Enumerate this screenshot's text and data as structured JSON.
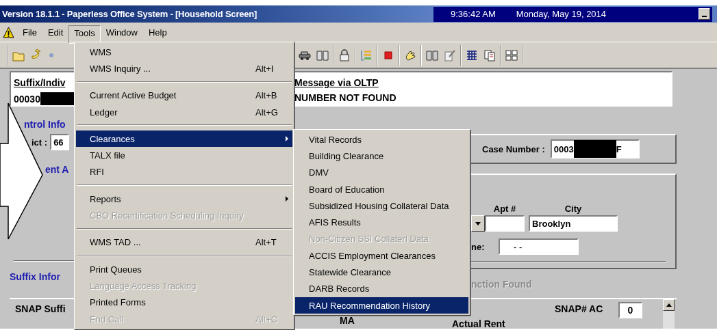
{
  "window": {
    "title": "Version 18.1.1 - Paperless Office System - [Household Screen]",
    "time": "9:36:42 AM",
    "date": "Monday, May 19, 2014"
  },
  "menu_bar": [
    {
      "label": "File",
      "selected": false
    },
    {
      "label": "Edit",
      "selected": false
    },
    {
      "label": "Tools",
      "selected": true
    },
    {
      "label": "Window",
      "selected": false
    },
    {
      "label": "Help",
      "selected": false
    }
  ],
  "tools_menu": [
    {
      "kind": "item",
      "label": "WMS",
      "selected": false,
      "disabled": false,
      "submenu": false
    },
    {
      "kind": "item",
      "label": "WMS Inquiry ...",
      "shortcut": "Alt+I",
      "selected": false,
      "disabled": false,
      "submenu": false
    },
    {
      "kind": "separator"
    },
    {
      "kind": "item",
      "label": "Current Active Budget",
      "shortcut": "Alt+B",
      "selected": false,
      "disabled": false,
      "submenu": false
    },
    {
      "kind": "item",
      "label": "Ledger",
      "shortcut": "Alt+G",
      "selected": false,
      "disabled": false,
      "submenu": false
    },
    {
      "kind": "separator"
    },
    {
      "kind": "item",
      "label": "Clearances",
      "selected": true,
      "disabled": false,
      "submenu": true
    },
    {
      "kind": "item",
      "label": "TALX file",
      "selected": false,
      "disabled": false,
      "submenu": false
    },
    {
      "kind": "item",
      "label": "RFI",
      "selected": false,
      "disabled": false,
      "submenu": false
    },
    {
      "kind": "separator"
    },
    {
      "kind": "item",
      "label": "Reports",
      "selected": false,
      "disabled": false,
      "submenu": true
    },
    {
      "kind": "item",
      "label": "CBO Recertification Scheduling Inquiry",
      "selected": false,
      "disabled": true,
      "submenu": false
    },
    {
      "kind": "separator"
    },
    {
      "kind": "item",
      "label": "WMS TAD ...",
      "shortcut": "Alt+T",
      "selected": false,
      "disabled": false,
      "submenu": false
    },
    {
      "kind": "separator"
    },
    {
      "kind": "item",
      "label": "Print Queues",
      "selected": false,
      "disabled": false,
      "submenu": false
    },
    {
      "kind": "item",
      "label": "Language Access Tracking",
      "selected": false,
      "disabled": true,
      "submenu": false
    },
    {
      "kind": "item",
      "label": "Printed Forms",
      "selected": false,
      "disabled": false,
      "submenu": false
    },
    {
      "kind": "item",
      "label": "End Call",
      "shortcut": "Alt+C",
      "selected": false,
      "disabled": true,
      "submenu": false
    }
  ],
  "clearances_menu": [
    {
      "kind": "item",
      "label": "Vital Records",
      "selected": false,
      "disabled": false
    },
    {
      "kind": "item",
      "label": "Building Clearance",
      "selected": false,
      "disabled": false
    },
    {
      "kind": "item",
      "label": "DMV",
      "selected": false,
      "disabled": false
    },
    {
      "kind": "item",
      "label": "Board of Education",
      "selected": false,
      "disabled": false
    },
    {
      "kind": "item",
      "label": "Subsidized Housing Collateral Data",
      "selected": false,
      "disabled": false
    },
    {
      "kind": "item",
      "label": "AFIS Results",
      "selected": false,
      "disabled": false
    },
    {
      "kind": "item",
      "label": "Non-Citizen SSI Collaterl Data",
      "selected": false,
      "disabled": true
    },
    {
      "kind": "item",
      "label": "ACCIS Employment Clearances",
      "selected": false,
      "disabled": false
    },
    {
      "kind": "item",
      "label": "Statewide Clearance",
      "selected": false,
      "disabled": false
    },
    {
      "kind": "item",
      "label": "DARB Records",
      "selected": false,
      "disabled": false
    },
    {
      "kind": "item",
      "label": "RAU Recommendation History",
      "selected": true,
      "disabled": false
    }
  ],
  "form": {
    "suffix_header": "Suffix/Indiv",
    "suffix_value": "00030",
    "message_heading": "Message via OLTP",
    "message_text": "NUMBER NOT FOUND",
    "control_heading": "ntrol Info",
    "district_label": "ict :",
    "district_value": "66",
    "address_heading": "ent A",
    "suffix_info_heading": "Suffix Infor",
    "case_label": "Case Number :",
    "case_value_start": "0003",
    "case_value_end": "F",
    "apt_label": "Apt #",
    "city_label": "City",
    "city_value": "Brooklyn",
    "phone_label": "ne:",
    "phone_value": "- -",
    "status_text": "nction Found",
    "snap_suffix_label": "SNAP Suffi",
    "ma_label": "MA",
    "rent_label": "Actual Rent",
    "snap_ac_label": "SNAP# AC",
    "snap_ac_value": "0"
  }
}
